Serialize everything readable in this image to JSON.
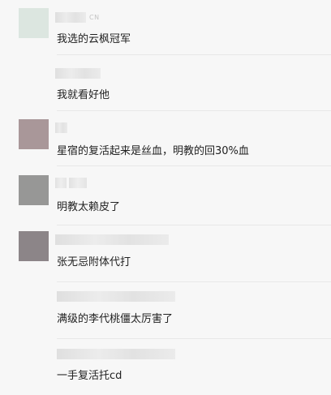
{
  "comments": [
    {
      "tag": "CN",
      "text": "我选的云枫冠军",
      "avatar_color": "#dce6e0"
    },
    {
      "tag": "",
      "text": "我就看好他",
      "avatar_color": ""
    },
    {
      "tag": "",
      "text": "星宿的复活起来是丝血，明教的回30%血",
      "avatar_color": "#a99799"
    },
    {
      "tag": "",
      "text": "明教太赖皮了",
      "avatar_color": "#979796"
    },
    {
      "tag": "",
      "text": "张无忌附体代打",
      "avatar_color": "#8c8588"
    },
    {
      "tag": "",
      "text": "满级的李代桃僵太厉害了",
      "avatar_color": ""
    },
    {
      "tag": "",
      "text": "一手复活托cd",
      "avatar_color": ""
    }
  ]
}
